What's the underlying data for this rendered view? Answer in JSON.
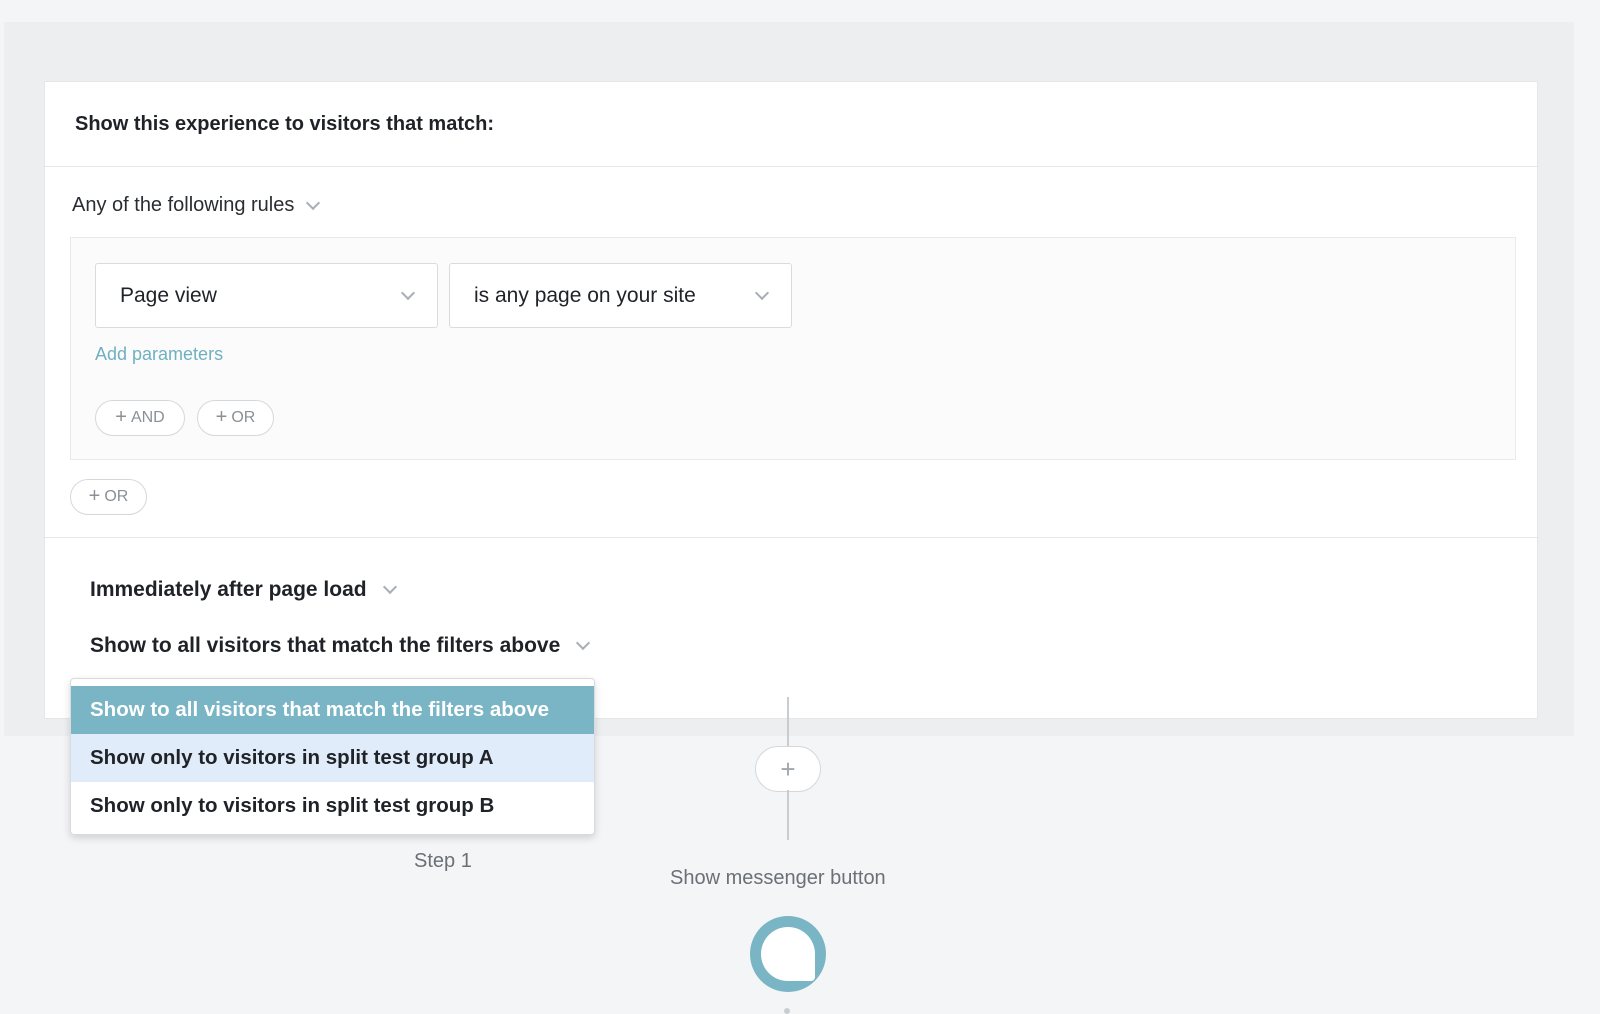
{
  "card": {
    "title": "Show this experience to visitors that match:"
  },
  "rules": {
    "match_type": "Any of the following rules",
    "condition": {
      "event": "Page view",
      "operator": "is any page on your site"
    },
    "add_parameters": "Add parameters",
    "and_button": "AND",
    "or_button": "OR",
    "group_or_button": "OR"
  },
  "timing": {
    "label": "Immediately after page load"
  },
  "audience": {
    "label": "Show to all visitors that match the filters above",
    "options": [
      "Show to all visitors that match the filters above",
      "Show only to visitors in split test group A",
      "Show only to visitors in split test group B"
    ]
  },
  "flow": {
    "add_step": "+",
    "step_label": "Step 1",
    "messenger_label": "Show messenger button"
  },
  "colors": {
    "accent": "#7ab5c5",
    "link": "#6fb0c1",
    "hover": "#e1ecfb"
  }
}
